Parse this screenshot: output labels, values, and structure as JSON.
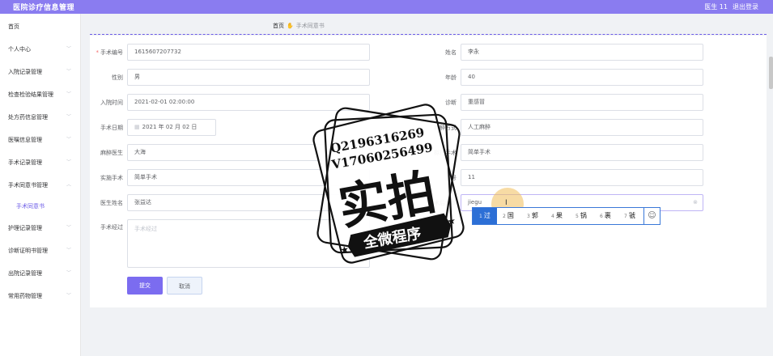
{
  "header": {
    "title": "医院诊疗信息管理",
    "user": "医生 11",
    "logout": "退出登录"
  },
  "sidebar": {
    "items": [
      {
        "label": "首页"
      },
      {
        "label": "个人中心"
      },
      {
        "label": "入院记录管理"
      },
      {
        "label": "检查检验结果管理"
      },
      {
        "label": "处方药信息管理"
      },
      {
        "label": "医嘱信息管理"
      },
      {
        "label": "手术记录管理"
      },
      {
        "label": "手术同意书管理"
      },
      {
        "label": "手术同意书"
      },
      {
        "label": "护理记录管理"
      },
      {
        "label": "诊断证明书管理"
      },
      {
        "label": "出院记录管理"
      },
      {
        "label": "常用药物管理"
      }
    ]
  },
  "breadcrumb": {
    "home": "首页",
    "current": "手术同意书"
  },
  "form": {
    "surgery_no": {
      "label": "手术编号",
      "value": "1615607207732"
    },
    "name": {
      "label": "姓名",
      "value": "李永"
    },
    "gender": {
      "label": "性别",
      "value": "男"
    },
    "age": {
      "label": "年龄",
      "value": "40"
    },
    "admit_time": {
      "label": "入院时间",
      "value": "2021-02-01 02:00:00"
    },
    "diagnosis": {
      "label": "诊断",
      "value": "重感冒"
    },
    "surgery_date": {
      "label": "手术日期",
      "value": "2021 年 02 月 02 日"
    },
    "anesthesia_method": {
      "label": "麻醉方式",
      "value": "人工麻醉"
    },
    "anesthetist": {
      "label": "麻醉医生",
      "value": "大海"
    },
    "planned_surgery": {
      "label": "拟行手术",
      "value": "简单手术"
    },
    "actual_surgery": {
      "label": "实施手术",
      "value": "简单手术"
    },
    "employee_no": {
      "label": "工号",
      "value": "11"
    },
    "doctor_name": {
      "label": "医生姓名",
      "value": "张益达"
    },
    "postop_diagnosis": {
      "label": "术后诊断",
      "value": "jiegu"
    },
    "surgery_course": {
      "label": "手术经过",
      "placeholder": "手术经过"
    },
    "submit": "提交",
    "cancel": "取消"
  },
  "ime": {
    "candidates": [
      {
        "n": "1",
        "text": "过"
      },
      {
        "n": "2",
        "text": "国"
      },
      {
        "n": "3",
        "text": "郭"
      },
      {
        "n": "4",
        "text": "果"
      },
      {
        "n": "5",
        "text": "锅"
      },
      {
        "n": "6",
        "text": "裹"
      },
      {
        "n": "7",
        "text": "虢"
      }
    ],
    "emoji": "☺"
  },
  "watermark": {
    "line1": "Q2196316269",
    "line2": "V17060256499",
    "main": "实拍",
    "banner": "全微程序"
  }
}
